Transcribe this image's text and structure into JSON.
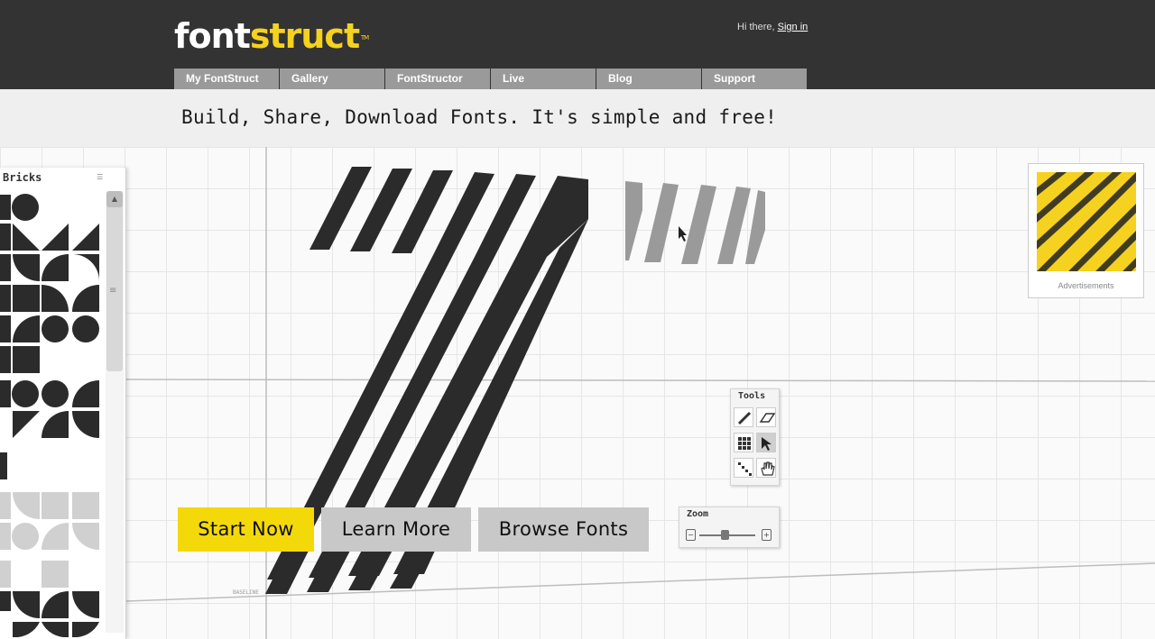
{
  "header": {
    "logo": {
      "part1": "font",
      "part2": "struct",
      "tm": "TM"
    },
    "greeting": "Hi there,",
    "signin": "Sign in"
  },
  "nav": {
    "tabs": [
      {
        "label": "My FontStruct"
      },
      {
        "label": "Gallery"
      },
      {
        "label": "FontStructor"
      },
      {
        "label": "Live"
      },
      {
        "label": "Blog"
      },
      {
        "label": "Support"
      }
    ]
  },
  "tagline": "Build, Share, Download Fonts. It's simple and free!",
  "bricks_panel": {
    "title": "Bricks"
  },
  "advert": {
    "label": "Advertisements"
  },
  "tools_panel": {
    "title": "Tools"
  },
  "zoom_panel": {
    "title": "Zoom"
  },
  "cta": {
    "start": "Start Now",
    "learn": "Learn More",
    "browse": "Browse Fonts"
  },
  "colors": {
    "header_bg": "#333333",
    "accent_yellow": "#f4d90a",
    "nav_tab": "#9a9a9a",
    "band_bg": "#efefef"
  }
}
